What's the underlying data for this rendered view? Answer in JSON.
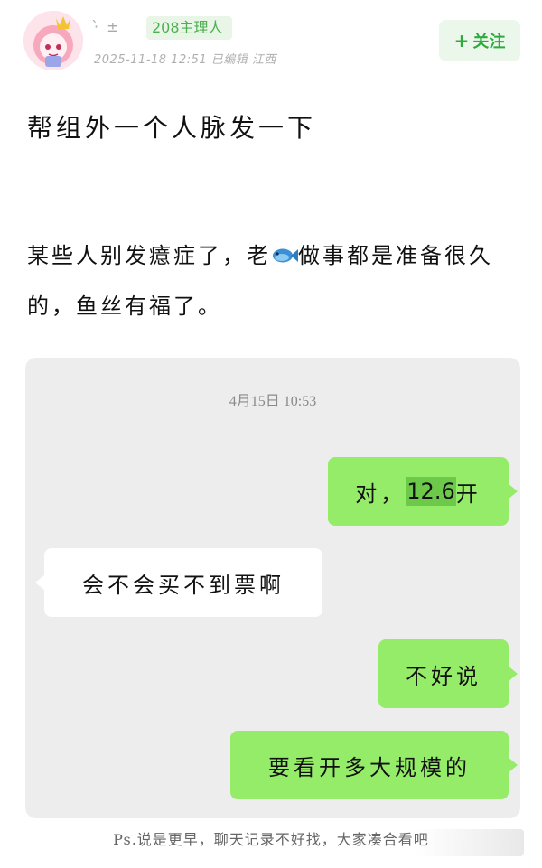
{
  "header": {
    "username": "·̀ ±",
    "role_badge": "208主理人",
    "meta": "2025-11-18 12:51  已编辑  江西",
    "follow_label": "关注",
    "follow_icon": "plus-icon"
  },
  "post": {
    "title": "帮组外一个人脉发一下",
    "body_part1": "某些人别发癔症了，老",
    "body_icon": "fish-emoji",
    "body_part2": "做事都是准备很久的，鱼丝有福了。"
  },
  "chat": {
    "timestamp": "4月15日 10:53",
    "messages": [
      {
        "side": "right",
        "prefix": "对，",
        "highlight": "12.6",
        "suffix": "开"
      },
      {
        "side": "left",
        "text": "会不会买不到票啊"
      },
      {
        "side": "right",
        "text": "不好说"
      },
      {
        "side": "right",
        "text": "要看开多大规模的"
      }
    ]
  },
  "footer": {
    "note": "Ps.说是更早，聊天记录不好找，大家凑合看吧"
  },
  "colors": {
    "accent_green": "#2eaa3e",
    "bubble_green": "#95ec69",
    "chat_bg": "#ededed"
  }
}
